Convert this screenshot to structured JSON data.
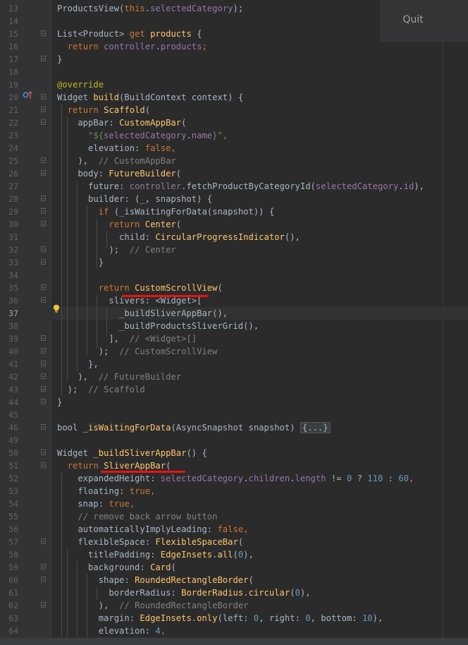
{
  "quit_button": {
    "label": "Quit"
  },
  "lines": [
    {
      "n": "13",
      "parts": [
        [
          "ProductsView(",
          ""
        ],
        [
          "this",
          ".kw"
        ],
        [
          ".",
          ""
        ],
        [
          "selectedCategory",
          "prop"
        ],
        [
          ");",
          ""
        ]
      ]
    },
    {
      "n": "14",
      "parts": []
    },
    {
      "n": "15",
      "parts": [
        [
          "List<Product> ",
          ""
        ],
        [
          "get ",
          "kw"
        ],
        [
          "products",
          "fn"
        ],
        [
          " {",
          ""
        ]
      ]
    },
    {
      "n": "16",
      "parts": [
        [
          "  ",
          ""
        ],
        [
          "return ",
          "kw"
        ],
        [
          "controller",
          "prop"
        ],
        [
          ".",
          ""
        ],
        [
          "products",
          "prop"
        ],
        [
          ";",
          "kw"
        ]
      ]
    },
    {
      "n": "17",
      "parts": [
        [
          "}",
          ""
        ]
      ]
    },
    {
      "n": "18",
      "parts": []
    },
    {
      "n": "19",
      "parts": [
        [
          "@override",
          "ann"
        ]
      ]
    },
    {
      "n": "20",
      "parts": [
        [
          "Widget ",
          ""
        ],
        [
          "build",
          "fn"
        ],
        [
          "(BuildContext context) {",
          ""
        ]
      ]
    },
    {
      "n": "21",
      "parts": [
        [
          "  ",
          ""
        ],
        [
          "return ",
          "kw"
        ],
        [
          "Scaffold",
          "cls"
        ],
        [
          "(",
          ""
        ]
      ]
    },
    {
      "n": "22",
      "parts": [
        [
          "    appBar: ",
          ""
        ],
        [
          "CustomAppBar",
          "cls"
        ],
        [
          "(",
          ""
        ]
      ]
    },
    {
      "n": "23",
      "parts": [
        [
          "      ",
          ""
        ],
        [
          "\"${",
          "str"
        ],
        [
          "selectedCategory",
          "prop"
        ],
        [
          ".",
          ""
        ],
        [
          "name",
          "prop"
        ],
        [
          "}\"",
          "str"
        ],
        [
          ",",
          "kw"
        ]
      ]
    },
    {
      "n": "24",
      "parts": [
        [
          "      elevation: ",
          ""
        ],
        [
          "false",
          "kw"
        ],
        [
          ",",
          "kw"
        ]
      ]
    },
    {
      "n": "25",
      "parts": [
        [
          "    ),  ",
          ""
        ],
        [
          "// CustomAppBar",
          "cmt"
        ]
      ]
    },
    {
      "n": "26",
      "parts": [
        [
          "    body: ",
          ""
        ],
        [
          "FutureBuilder",
          "cls"
        ],
        [
          "(",
          ""
        ]
      ]
    },
    {
      "n": "27",
      "parts": [
        [
          "      future: ",
          ""
        ],
        [
          "controller",
          "prop"
        ],
        [
          ".fetchProductByCategoryId(",
          ""
        ],
        [
          "selectedCategory",
          "prop"
        ],
        [
          ".",
          ""
        ],
        [
          "id",
          "prop"
        ],
        [
          "),",
          ""
        ]
      ]
    },
    {
      "n": "28",
      "parts": [
        [
          "      builder: (_, snapshot) {",
          ""
        ]
      ]
    },
    {
      "n": "29",
      "parts": [
        [
          "        ",
          ""
        ],
        [
          "if ",
          "kw"
        ],
        [
          "(_isWaitingForData(snapshot)) {",
          ""
        ]
      ]
    },
    {
      "n": "30",
      "parts": [
        [
          "          ",
          ""
        ],
        [
          "return ",
          "kw"
        ],
        [
          "Center",
          "cls"
        ],
        [
          "(",
          ""
        ]
      ]
    },
    {
      "n": "31",
      "parts": [
        [
          "            child: ",
          ""
        ],
        [
          "CircularProgressIndicator",
          "cls"
        ],
        [
          "(),",
          ""
        ]
      ]
    },
    {
      "n": "32",
      "parts": [
        [
          "          );  ",
          ""
        ],
        [
          "// Center",
          "cmt"
        ]
      ]
    },
    {
      "n": "33",
      "parts": [
        [
          "        }",
          ""
        ]
      ]
    },
    {
      "n": "34",
      "parts": []
    },
    {
      "n": "35",
      "parts": [
        [
          "        ",
          ""
        ],
        [
          "return ",
          "kw"
        ],
        [
          "CustomScrollView",
          "cls"
        ],
        [
          "(",
          ""
        ]
      ]
    },
    {
      "n": "36",
      "parts": [
        [
          "          slivers: <Widget>[",
          ""
        ]
      ]
    },
    {
      "n": "37",
      "parts": [
        [
          "            _buildSliverAppBar(),",
          ""
        ]
      ]
    },
    {
      "n": "38",
      "parts": [
        [
          "            _buildProductsSliverGrid(),",
          ""
        ]
      ]
    },
    {
      "n": "39",
      "parts": [
        [
          "          ],  ",
          ""
        ],
        [
          "// <Widget>[]",
          "cmt"
        ]
      ]
    },
    {
      "n": "40",
      "parts": [
        [
          "        );  ",
          ""
        ],
        [
          "// CustomScrollView",
          "cmt"
        ]
      ]
    },
    {
      "n": "41",
      "parts": [
        [
          "      },",
          ""
        ]
      ]
    },
    {
      "n": "42",
      "parts": [
        [
          "    ),  ",
          ""
        ],
        [
          "// FutureBuilder",
          "cmt"
        ]
      ]
    },
    {
      "n": "43",
      "parts": [
        [
          "  );  ",
          ""
        ],
        [
          "// Scaffold",
          "cmt"
        ]
      ]
    },
    {
      "n": "44",
      "parts": [
        [
          "}",
          ""
        ]
      ]
    },
    {
      "n": "45",
      "parts": []
    },
    {
      "n": "46",
      "parts": [
        [
          "bool ",
          ""
        ],
        [
          "_isWaitingForData",
          "fn"
        ],
        [
          "(AsyncSnapshot snapshot) ",
          ""
        ],
        [
          "{...}",
          "folded"
        ]
      ]
    },
    {
      "n": "49",
      "parts": []
    },
    {
      "n": "50",
      "parts": [
        [
          "Widget ",
          ""
        ],
        [
          "_buildSliverAppBar",
          "fn"
        ],
        [
          "() {",
          ""
        ]
      ]
    },
    {
      "n": "51",
      "parts": [
        [
          "  ",
          ""
        ],
        [
          "return ",
          "kw"
        ],
        [
          "SliverAppBar",
          "cls"
        ],
        [
          "(",
          ""
        ]
      ]
    },
    {
      "n": "52",
      "parts": [
        [
          "    expandedHeight: ",
          ""
        ],
        [
          "selectedCategory",
          "prop"
        ],
        [
          ".",
          ""
        ],
        [
          "children",
          "prop"
        ],
        [
          ".",
          ""
        ],
        [
          "length",
          "prop"
        ],
        [
          " != ",
          ""
        ],
        [
          "0",
          "num"
        ],
        [
          " ? ",
          ""
        ],
        [
          "110",
          "num"
        ],
        [
          " : ",
          ""
        ],
        [
          "60",
          "num"
        ],
        [
          ",",
          "kw"
        ]
      ]
    },
    {
      "n": "53",
      "parts": [
        [
          "    floating: ",
          ""
        ],
        [
          "true",
          "kw"
        ],
        [
          ",",
          "kw"
        ]
      ]
    },
    {
      "n": "54",
      "parts": [
        [
          "    snap: ",
          ""
        ],
        [
          "true",
          "kw"
        ],
        [
          ",",
          "kw"
        ]
      ]
    },
    {
      "n": "55",
      "parts": [
        [
          "    ",
          ""
        ],
        [
          "// remove back arrow button",
          "cmt"
        ]
      ]
    },
    {
      "n": "56",
      "parts": [
        [
          "    automaticallyImplyLeading: ",
          ""
        ],
        [
          "false",
          "kw"
        ],
        [
          ",",
          "kw"
        ]
      ]
    },
    {
      "n": "57",
      "parts": [
        [
          "    flexibleSpace: ",
          ""
        ],
        [
          "FlexibleSpaceBar",
          "cls"
        ],
        [
          "(",
          ""
        ]
      ]
    },
    {
      "n": "58",
      "parts": [
        [
          "      titlePadding: ",
          ""
        ],
        [
          "EdgeInsets",
          "cls"
        ],
        [
          ".",
          ""
        ],
        [
          "all",
          "fn"
        ],
        [
          "(",
          ""
        ],
        [
          "0",
          "num"
        ],
        [
          "),",
          ""
        ]
      ]
    },
    {
      "n": "59",
      "parts": [
        [
          "      background: ",
          ""
        ],
        [
          "Card",
          "cls"
        ],
        [
          "(",
          ""
        ]
      ]
    },
    {
      "n": "60",
      "parts": [
        [
          "        shape: ",
          ""
        ],
        [
          "RoundedRectangleBorder",
          "cls"
        ],
        [
          "(",
          ""
        ]
      ]
    },
    {
      "n": "61",
      "parts": [
        [
          "          borderRadius: ",
          ""
        ],
        [
          "BorderRadius",
          "cls"
        ],
        [
          ".",
          ""
        ],
        [
          "circular",
          "fn"
        ],
        [
          "(",
          ""
        ],
        [
          "0",
          "num"
        ],
        [
          "),",
          ""
        ]
      ]
    },
    {
      "n": "62",
      "parts": [
        [
          "        ),  ",
          ""
        ],
        [
          "// RoundedRectangleBorder",
          "cmt"
        ]
      ]
    },
    {
      "n": "63",
      "parts": [
        [
          "        margin: ",
          ""
        ],
        [
          "EdgeInsets",
          "cls"
        ],
        [
          ".",
          ""
        ],
        [
          "only",
          "fn"
        ],
        [
          "(left: ",
          ""
        ],
        [
          "0",
          "num"
        ],
        [
          ", right: ",
          ""
        ],
        [
          "0",
          "num"
        ],
        [
          ", bottom: ",
          ""
        ],
        [
          "10",
          "num"
        ],
        [
          "),",
          ""
        ]
      ]
    },
    {
      "n": "64",
      "parts": [
        [
          "        elevation: ",
          ""
        ],
        [
          "4",
          "num"
        ],
        [
          ",",
          "kw"
        ]
      ]
    }
  ],
  "fold_rows": [
    "15",
    "17",
    "20",
    "21",
    "22",
    "25",
    "26",
    "28",
    "29",
    "30",
    "32",
    "33",
    "35",
    "36",
    "39",
    "40",
    "41",
    "42",
    "43",
    "44",
    "46",
    "50",
    "51",
    "57",
    "59",
    "60",
    "62"
  ],
  "current_line": "37",
  "colors": {
    "keyword": "#cc7832",
    "function": "#ffc66d",
    "property": "#9876aa",
    "string": "#6a8759",
    "number": "#6897bb",
    "comment": "#808080",
    "annotation": "#bbb529",
    "text": "#a9b7c6",
    "underline": "#ee1111"
  },
  "icons": {
    "override_marker": "override-gutter-icon",
    "intention_bulb": "lightbulb-icon"
  }
}
